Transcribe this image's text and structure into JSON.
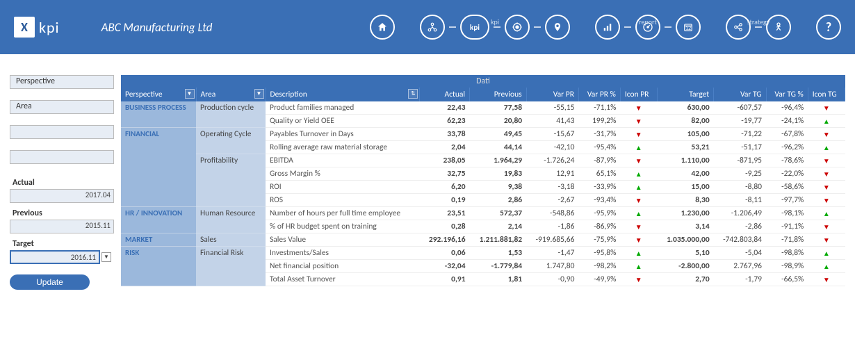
{
  "header": {
    "company": "ABC Manufacturing Ltd",
    "logo_text": "kpi",
    "nav_labels": {
      "kpi": "kpi",
      "report": "report",
      "strategy": "strategy"
    },
    "kpi_label": "kpi"
  },
  "sidebar": {
    "filters": [
      {
        "label": "Perspective",
        "value": ""
      },
      {
        "label": "Area",
        "value": ""
      },
      {
        "label": "",
        "value": ""
      },
      {
        "label": "",
        "value": ""
      }
    ],
    "actual_label": "Actual",
    "actual_value": "2017.04",
    "previous_label": "Previous",
    "previous_value": "2015.11",
    "target_label": "Target",
    "target_value": "2016.11",
    "update_label": "Update"
  },
  "table": {
    "title": "Dati",
    "headers": {
      "perspective": "Perspective",
      "area": "Area",
      "description": "Description",
      "actual": "Actual",
      "previous": "Previous",
      "varpr": "Var PR",
      "varprp": "Var PR %",
      "iconpr": "Icon PR",
      "target": "Target",
      "vartg": "Var TG",
      "vartgp": "Var TG %",
      "icontg": "Icon TG"
    },
    "rows": [
      {
        "perspective": "BUSINESS PROCESS",
        "area": "Production cycle",
        "desc": "Product families managed",
        "actual": "22,43",
        "prev": "77,58",
        "varpr": "-55,15",
        "varprp": "-71,1%",
        "iconpr": "down",
        "target": "630,00",
        "vartg": "-607,57",
        "vartgp": "-96,4%",
        "icontg": "down",
        "prows": 2,
        "arows": 2
      },
      {
        "perspective": "",
        "area": "",
        "desc": "Quality or Yield OEE",
        "actual": "62,23",
        "prev": "20,80",
        "varpr": "41,43",
        "varprp": "199,2%",
        "iconpr": "down",
        "target": "82,00",
        "vartg": "-19,77",
        "vartgp": "-24,1%",
        "icontg": "up"
      },
      {
        "perspective": "FINANCIAL",
        "area": "Operating Cycle",
        "desc": "Payables Turnover in Days",
        "actual": "33,78",
        "prev": "49,45",
        "varpr": "-15,67",
        "varprp": "-31,7%",
        "iconpr": "down",
        "target": "105,00",
        "vartg": "-71,22",
        "vartgp": "-67,8%",
        "icontg": "down",
        "prows": 6,
        "arows": 2
      },
      {
        "perspective": "",
        "area": "",
        "desc": "Rolling average raw material storage",
        "actual": "2,04",
        "prev": "44,14",
        "varpr": "-42,10",
        "varprp": "-95,4%",
        "iconpr": "up",
        "target": "53,21",
        "vartg": "-51,17",
        "vartgp": "-96,2%",
        "icontg": "up"
      },
      {
        "perspective": "",
        "area": "Profitability",
        "desc": "EBITDA",
        "actual": "238,05",
        "prev": "1.964,29",
        "varpr": "-1.726,24",
        "varprp": "-87,9%",
        "iconpr": "down",
        "target": "1.110,00",
        "vartg": "-871,95",
        "vartgp": "-78,6%",
        "icontg": "down",
        "arows": 4
      },
      {
        "perspective": "",
        "area": "",
        "desc": "Gross Margin %",
        "actual": "32,75",
        "prev": "19,83",
        "varpr": "12,91",
        "varprp": "65,1%",
        "iconpr": "up",
        "target": "42,00",
        "vartg": "-9,25",
        "vartgp": "-22,0%",
        "icontg": "down"
      },
      {
        "perspective": "",
        "area": "",
        "desc": "ROI",
        "actual": "6,20",
        "prev": "9,38",
        "varpr": "-3,18",
        "varprp": "-33,9%",
        "iconpr": "up",
        "target": "15,00",
        "vartg": "-8,80",
        "vartgp": "-58,6%",
        "icontg": "down"
      },
      {
        "perspective": "",
        "area": "",
        "desc": "ROS",
        "actual": "0,19",
        "prev": "2,86",
        "varpr": "-2,67",
        "varprp": "-93,4%",
        "iconpr": "down",
        "target": "8,30",
        "vartg": "-8,11",
        "vartgp": "-97,7%",
        "icontg": "down"
      },
      {
        "perspective": "HR / INNOVATION",
        "area": "Human Resource",
        "desc": "Number of hours per full time employee",
        "actual": "23,51",
        "prev": "572,37",
        "varpr": "-548,86",
        "varprp": "-95,9%",
        "iconpr": "up",
        "target": "1.230,00",
        "vartg": "-1.206,49",
        "vartgp": "-98,1%",
        "icontg": "up",
        "prows": 2,
        "arows": 2
      },
      {
        "perspective": "",
        "area": "",
        "desc": "% of HR budget spent on training",
        "actual": "0,28",
        "prev": "2,14",
        "varpr": "-1,86",
        "varprp": "-86,9%",
        "iconpr": "down",
        "target": "3,14",
        "vartg": "-2,86",
        "vartgp": "-91,1%",
        "icontg": "down"
      },
      {
        "perspective": "MARKET",
        "area": "Sales",
        "desc": "Sales Value",
        "actual": "292.196,16",
        "prev": "1.211.881,82",
        "varpr": "-919.685,66",
        "varprp": "-75,9%",
        "iconpr": "down",
        "target": "1.035.000,00",
        "vartg": "-742.803,84",
        "vartgp": "-71,8%",
        "icontg": "down",
        "prows": 1,
        "arows": 1
      },
      {
        "perspective": "RISK",
        "area": "Financial Risk",
        "desc": "Investments/Sales",
        "actual": "0,06",
        "prev": "1,53",
        "varpr": "-1,47",
        "varprp": "-95,8%",
        "iconpr": "up",
        "target": "5,10",
        "vartg": "-5,04",
        "vartgp": "-98,8%",
        "icontg": "up",
        "prows": 3,
        "arows": 3
      },
      {
        "perspective": "",
        "area": "",
        "desc": "Net financial position",
        "actual": "-32,04",
        "prev": "-1.779,84",
        "varpr": "1.747,80",
        "varprp": "-98,2%",
        "iconpr": "up",
        "target": "-2.800,00",
        "vartg": "2.767,96",
        "vartgp": "-98,9%",
        "icontg": "up"
      },
      {
        "perspective": "",
        "area": "",
        "desc": "Total Asset Turnover",
        "actual": "0,91",
        "prev": "1,81",
        "varpr": "-0,90",
        "varprp": "-49,9%",
        "iconpr": "down",
        "target": "2,70",
        "vartg": "-1,79",
        "vartgp": "-66,5%",
        "icontg": "down"
      }
    ]
  }
}
